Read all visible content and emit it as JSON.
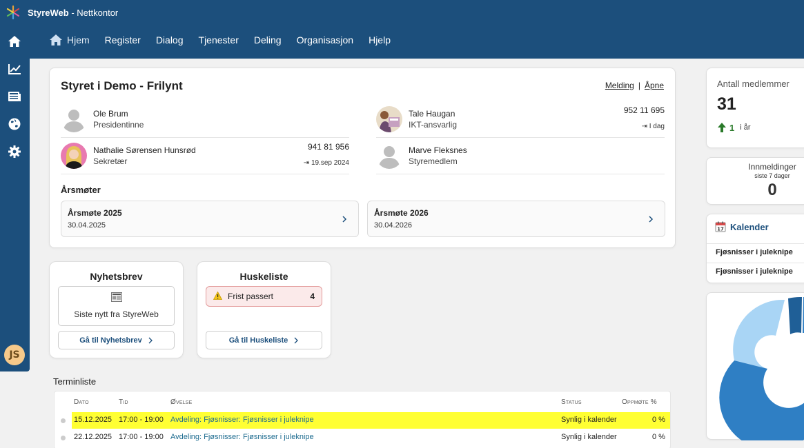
{
  "app": {
    "brand": "StyreWeb",
    "title_suffix": " - Nettkontor"
  },
  "nav": [
    {
      "label": "Hjem",
      "icon": "home-icon",
      "active": true
    },
    {
      "label": "Register"
    },
    {
      "label": "Dialog"
    },
    {
      "label": "Tjenester"
    },
    {
      "label": "Deling"
    },
    {
      "label": "Organisasjon"
    },
    {
      "label": "Hjelp"
    }
  ],
  "sidebar": {
    "icons": [
      "home-icon",
      "chart-icon",
      "news-icon",
      "globe-icon",
      "gear-icon"
    ],
    "user_initials": "JS"
  },
  "board": {
    "title": "Styret i Demo - Frilynt",
    "link_message": "Melding",
    "link_separator": "|",
    "link_open": "Åpne",
    "members": [
      {
        "name": "Ole Brum",
        "role": "Presidentinne",
        "phone": "",
        "seen": ""
      },
      {
        "name": "Tale Haugan",
        "role": "IKT-ansvarlig",
        "phone": "952 11 695",
        "seen": "I dag"
      },
      {
        "name": "Nathalie Sørensen Hunsrød",
        "role": "Sekretær",
        "phone": "941 81 956",
        "seen": "19.sep 2024"
      },
      {
        "name": "Marve Fleksnes",
        "role": "Styremedlem",
        "phone": "",
        "seen": ""
      }
    ],
    "meetings_label": "Årsmøter",
    "meetings": [
      {
        "title": "Årsmøte 2025",
        "date": "30.04.2025"
      },
      {
        "title": "Årsmøte 2026",
        "date": "30.04.2026"
      }
    ]
  },
  "newsletter": {
    "title": "Nyhetsbrev",
    "item": "Siste nytt fra StyreWeb",
    "button": "Gå til Nyhetsbrev"
  },
  "checklist": {
    "title": "Huskeliste",
    "alert_label": "Frist passert",
    "alert_count": "4",
    "button": "Gå til Huskeliste"
  },
  "termin": {
    "title": "Terminliste",
    "columns": [
      "Dato",
      "Tid",
      "Øvelse",
      "Status",
      "Oppmøte %"
    ],
    "rows": [
      {
        "date": "15.12.2025",
        "time": "17:00 - 19:00",
        "event": "Avdeling: Fjøsnisser: Fjøsnisser i juleknipe",
        "status": "Synlig i kalender",
        "attendance": "0 %",
        "highlight": true
      },
      {
        "date": "22.12.2025",
        "time": "17:00 - 19:00",
        "event": "Avdeling: Fjøsnisser: Fjøsnisser i juleknipe",
        "status": "Synlig i kalender",
        "attendance": "0 %",
        "highlight": false
      }
    ]
  },
  "members_stat": {
    "label": "Antall medlemmer",
    "value": "31",
    "delta": "1",
    "delta_period": "i år"
  },
  "submissions": {
    "label": "Innmeldinger",
    "sub": "siste 7 dager",
    "value": "0"
  },
  "calendar": {
    "title": "Kalender",
    "items": [
      "Fjøsnisser i juleknipe",
      "Fjøsnisser i juleknipe"
    ]
  },
  "colors": {
    "brand": "#1c4f7c",
    "highlight": "#ffff33",
    "trend_up": "#2a7a2a",
    "donut_dark": "#1f5f97",
    "donut_mid": "#2f7fc4",
    "donut_light": "#a9d5f5"
  }
}
